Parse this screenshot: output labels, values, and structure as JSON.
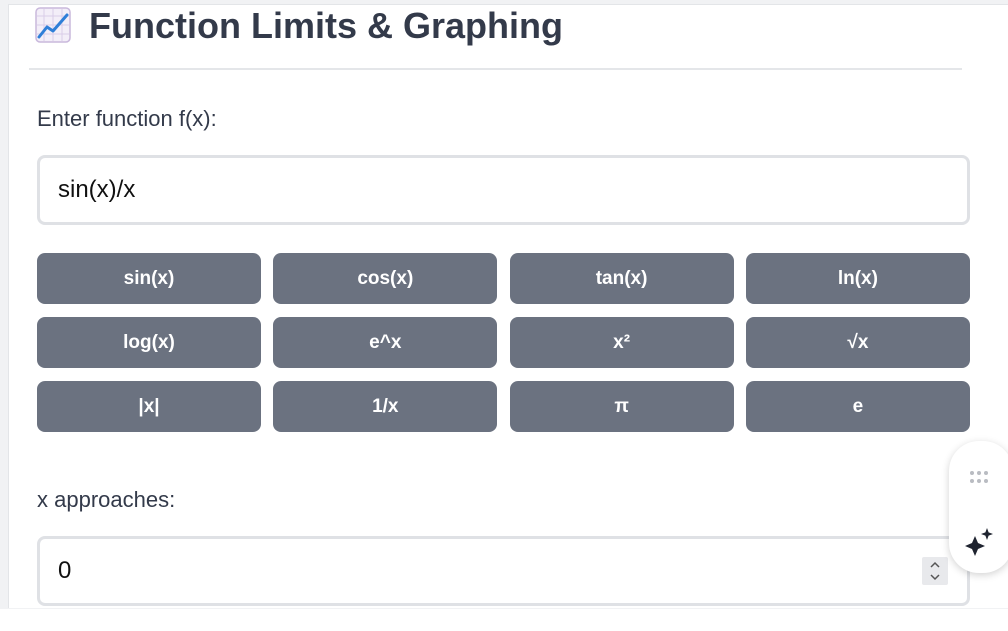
{
  "header": {
    "title": "Function Limits & Graphing",
    "icon": "chart-increasing-icon"
  },
  "function_input": {
    "label": "Enter function f(x):",
    "value": "sin(x)/x"
  },
  "function_buttons": [
    "sin(x)",
    "cos(x)",
    "tan(x)",
    "ln(x)",
    "log(x)",
    "e^x",
    "x²",
    "√x",
    "|x|",
    "1/x",
    "π",
    "e"
  ],
  "approach_input": {
    "label": "x approaches:",
    "value": "0"
  },
  "floating_toolbar": {
    "icons": [
      "grip-dots-icon",
      "sparkle-icon"
    ]
  },
  "colors": {
    "button_bg": "#6b7280",
    "button_text": "#ffffff",
    "heading_text": "#333a4a",
    "field_border": "#dfe1e5"
  }
}
